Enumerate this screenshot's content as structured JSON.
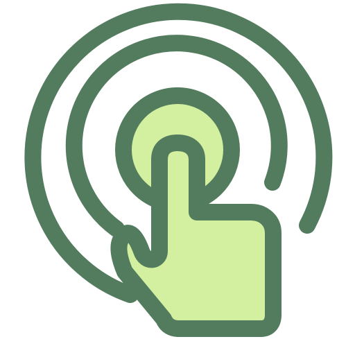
{
  "icon": {
    "name": "tap-gesture-icon",
    "colors": {
      "stroke": "#527C5D",
      "fill": "#D2F0A0",
      "background": "#FFFFFF"
    }
  }
}
